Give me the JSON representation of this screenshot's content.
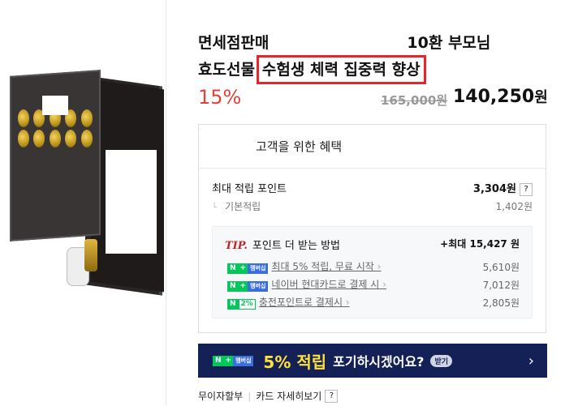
{
  "product": {
    "title_line1_left": "면세점판매",
    "title_line1_right": "10환 부모님",
    "title_line2_left": "효도선물",
    "title_highlight": "수험생 체력 집중력 향상"
  },
  "price": {
    "discount": "15%",
    "original": "165,000원",
    "sale_amount": "140,250",
    "sale_unit": "원"
  },
  "benefits": {
    "header": "고객을 위한 혜택",
    "max_points_label": "최대 적립 포인트",
    "max_points_value": "3,304원",
    "help": "?",
    "basic_label": "기본적립",
    "basic_value": "1,402원",
    "tip_label": "TIP.",
    "tip_text": "포인트 더 받는 방법",
    "tip_max": "+최대 15,427 원",
    "items": [
      {
        "badge": "membership",
        "label": "최대 5% 적립, 무료 시작",
        "value": "5,610원"
      },
      {
        "badge": "membership",
        "label": "네이버 현대카드로 결제 시",
        "value": "7,012원"
      },
      {
        "badge": "2%",
        "label": "충전포인트로 결제시",
        "value": "2,805원"
      }
    ],
    "badge_n": "N",
    "badge_plus": "+",
    "badge_mem": "멤버십"
  },
  "banner": {
    "percent": "5% 적립",
    "message": "포기하시겠어요?",
    "button": "받기",
    "chevron": "›"
  },
  "footer": {
    "link1": "무이자할부",
    "link2": "카드 자세히보기",
    "help": "?"
  }
}
